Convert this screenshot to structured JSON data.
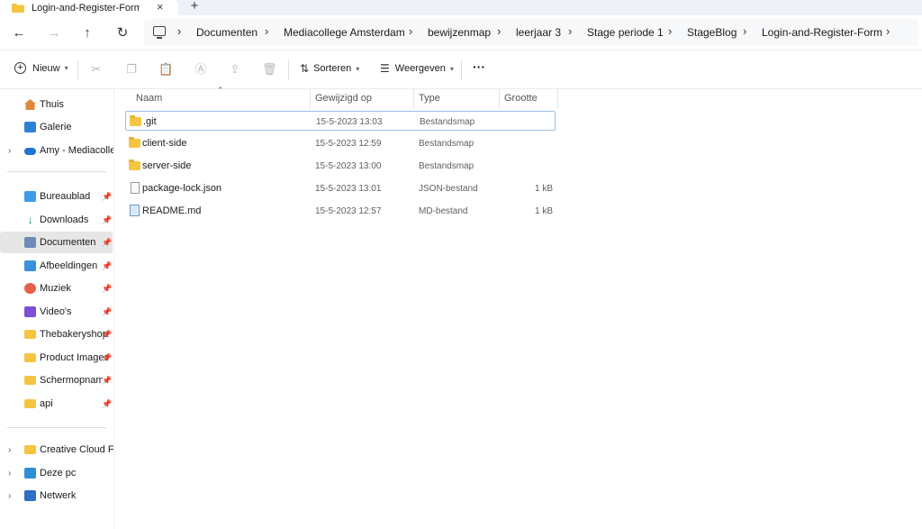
{
  "window": {
    "tab_title": "Login-and-Register-Form",
    "tab_close": "×",
    "new_tab": "+"
  },
  "nav": {
    "back": "←",
    "forward": "→",
    "up": "↑",
    "refresh": "↻",
    "breadcrumb_sep": "›",
    "breadcrumbs": [
      "Documenten",
      "Mediacollege Amsterdam",
      "bewijzenmap",
      "leerjaar 3",
      "Stage periode 1",
      "StageBlog",
      "Login-and-Register-Form"
    ]
  },
  "toolbar": {
    "new_label": "Nieuw",
    "sort_label": "Sorteren",
    "view_label": "Weergeven",
    "more_label": "···"
  },
  "sidebar": {
    "quick": [
      {
        "label": "Thuis",
        "icon": "home-icon",
        "color": "#e0873a"
      },
      {
        "label": "Galerie",
        "icon": "gallery-icon",
        "color": "#2f7fd4"
      },
      {
        "label": "Amy - Mediacollege",
        "icon": "onedrive-icon",
        "color": "#1f73d1"
      }
    ],
    "pinned": [
      {
        "label": "Bureaublad",
        "icon": "desktop-icon",
        "color": "#3a9be8"
      },
      {
        "label": "Downloads",
        "icon": "download-icon",
        "color": "#2ba36b"
      },
      {
        "label": "Documenten",
        "icon": "documents-icon",
        "color": "#6e8bb8",
        "selected": true
      },
      {
        "label": "Afbeeldingen",
        "icon": "pictures-icon",
        "color": "#3b8fde"
      },
      {
        "label": "Muziek",
        "icon": "music-icon",
        "color": "#e65f4a"
      },
      {
        "label": "Video's",
        "icon": "videos-icon",
        "color": "#7b4fd6"
      },
      {
        "label": "Thebakeryshop",
        "icon": "folder-icon",
        "color": "#f5c542"
      },
      {
        "label": "Product Images",
        "icon": "folder-icon",
        "color": "#f5c542"
      },
      {
        "label": "Schermopnamen",
        "icon": "folder-icon",
        "color": "#f5c542"
      },
      {
        "label": "api",
        "icon": "folder-icon",
        "color": "#f5c542"
      }
    ],
    "devices": [
      {
        "label": "Creative Cloud Files",
        "icon": "creative-cloud-icon",
        "color": "#f5c542"
      },
      {
        "label": "Deze pc",
        "icon": "pc-icon",
        "color": "#2f8fd4"
      },
      {
        "label": "Netwerk",
        "icon": "network-icon",
        "color": "#2f6fc4"
      }
    ],
    "pin_glyph": "📌"
  },
  "columns": {
    "name": "Naam",
    "modified": "Gewijzigd op",
    "type": "Type",
    "size": "Grootte"
  },
  "files": [
    {
      "name": ".git",
      "modified": "15-5-2023 13:03",
      "type": "Bestandsmap",
      "size": "",
      "kind": "folder"
    },
    {
      "name": "client-side",
      "modified": "15-5-2023 12:59",
      "type": "Bestandsmap",
      "size": "",
      "kind": "folder"
    },
    {
      "name": "server-side",
      "modified": "15-5-2023 13:00",
      "type": "Bestandsmap",
      "size": "",
      "kind": "folder"
    },
    {
      "name": "package-lock.json",
      "modified": "15-5-2023 13:01",
      "type": "JSON-bestand",
      "size": "1 kB",
      "kind": "doc"
    },
    {
      "name": "README.md",
      "modified": "15-5-2023 12:57",
      "type": "MD-bestand",
      "size": "1 kB",
      "kind": "md"
    }
  ]
}
